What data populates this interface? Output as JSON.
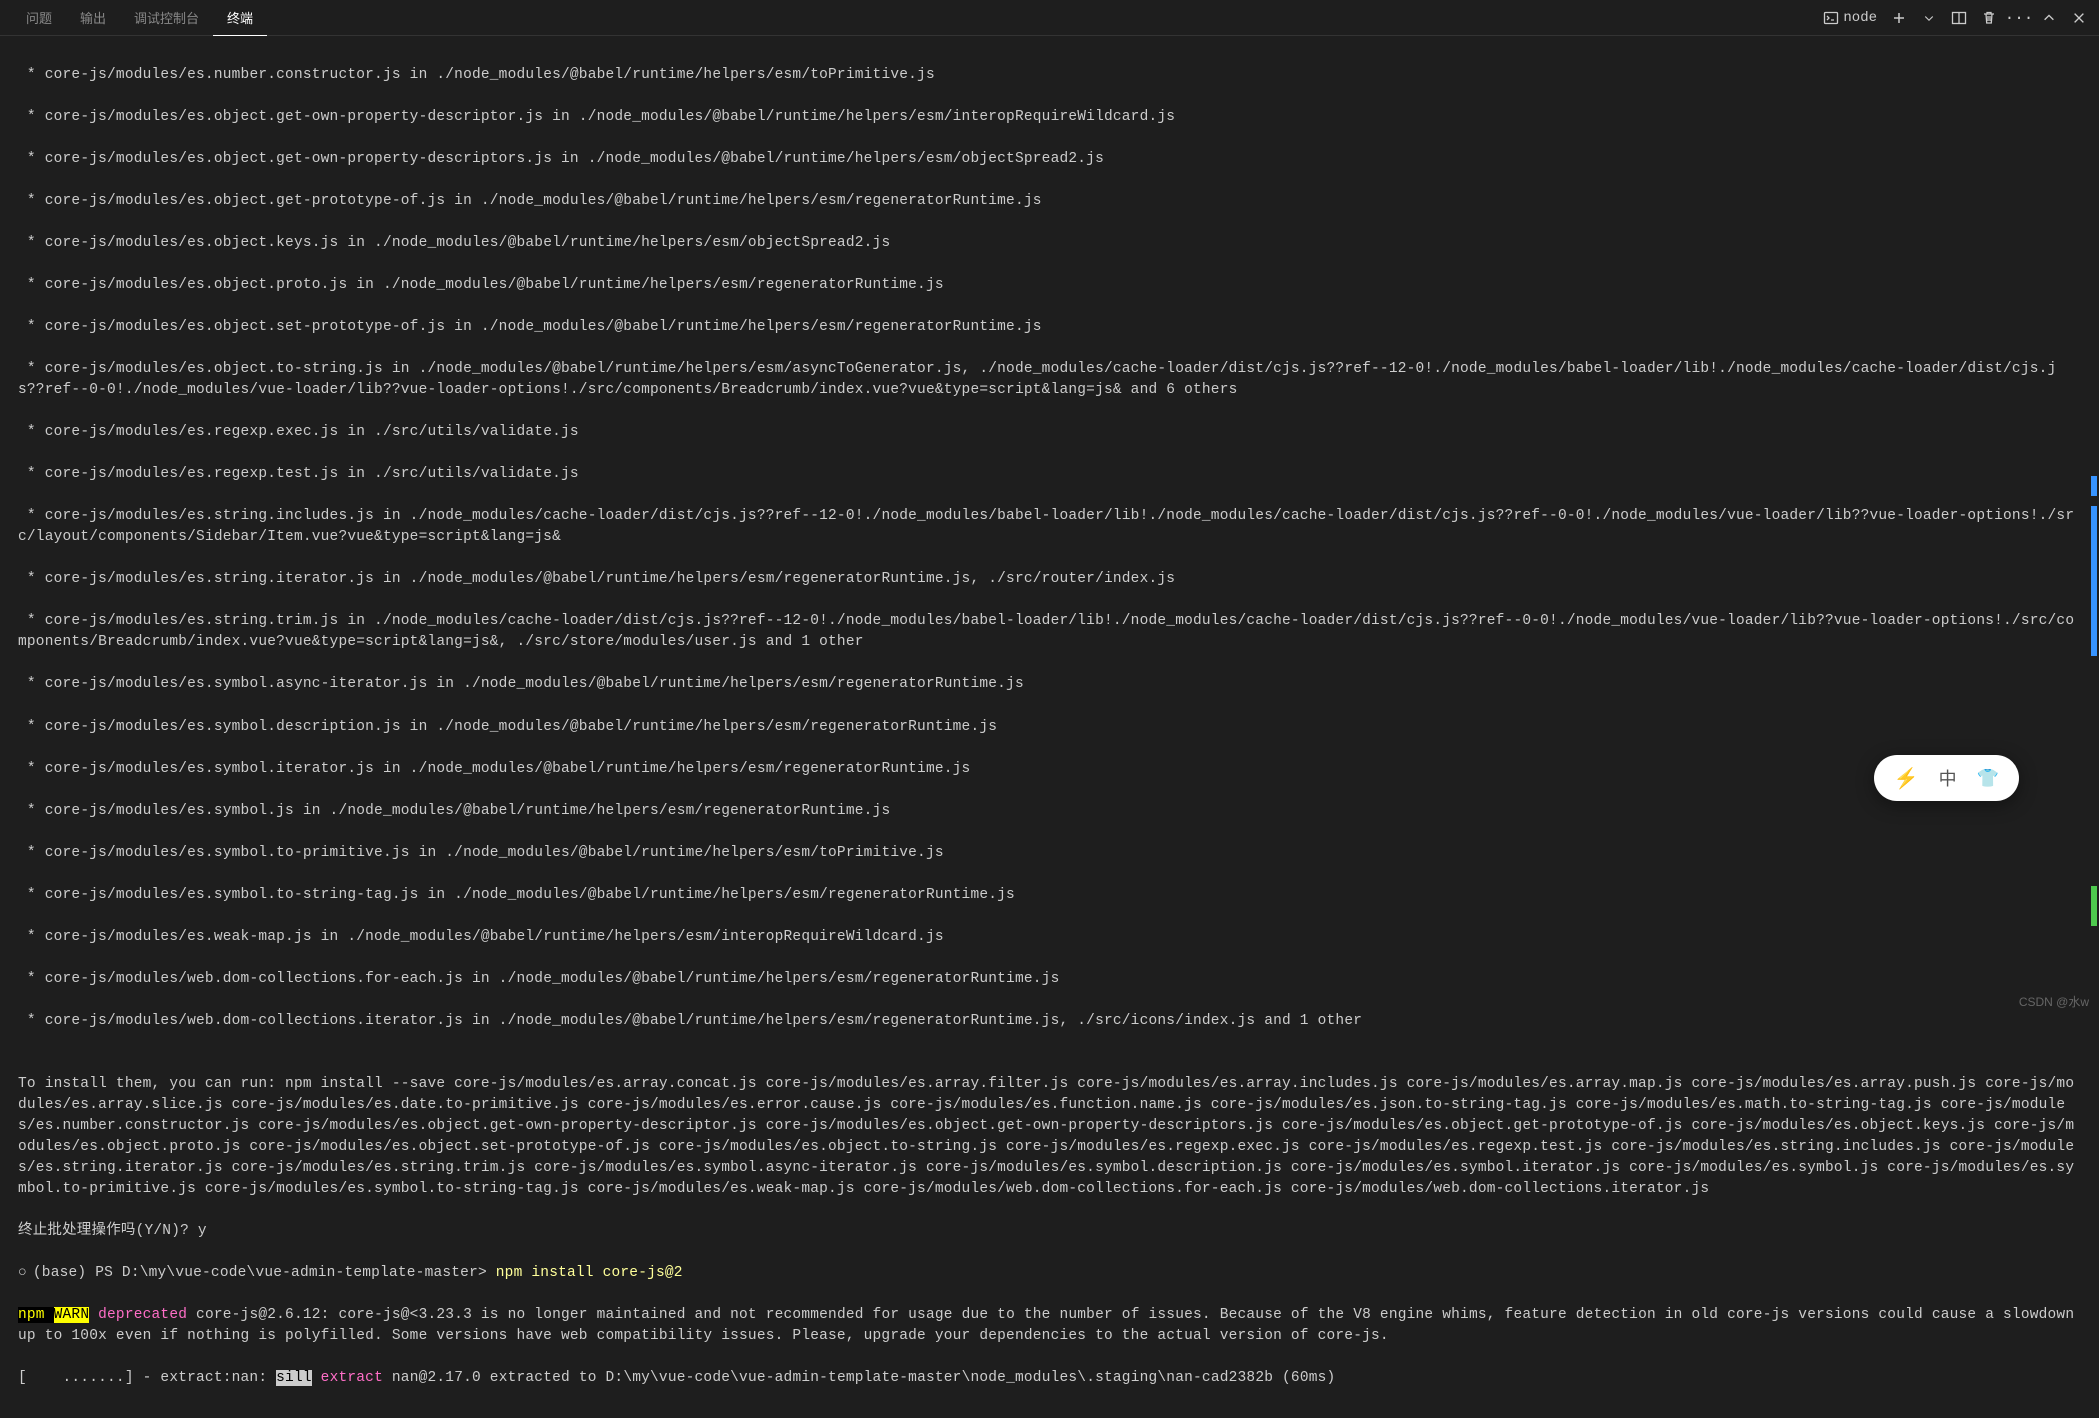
{
  "tabs": {
    "problems": "问题",
    "output": "输出",
    "debug": "调试控制台",
    "terminal": "终端"
  },
  "toolbar": {
    "node_label": "node"
  },
  "lines": {
    "l1": " * core-js/modules/es.number.constructor.js in ./node_modules/@babel/runtime/helpers/esm/toPrimitive.js",
    "l2": " * core-js/modules/es.object.get-own-property-descriptor.js in ./node_modules/@babel/runtime/helpers/esm/interopRequireWildcard.js",
    "l3": " * core-js/modules/es.object.get-own-property-descriptors.js in ./node_modules/@babel/runtime/helpers/esm/objectSpread2.js",
    "l4": " * core-js/modules/es.object.get-prototype-of.js in ./node_modules/@babel/runtime/helpers/esm/regeneratorRuntime.js",
    "l5": " * core-js/modules/es.object.keys.js in ./node_modules/@babel/runtime/helpers/esm/objectSpread2.js",
    "l6": " * core-js/modules/es.object.proto.js in ./node_modules/@babel/runtime/helpers/esm/regeneratorRuntime.js",
    "l7": " * core-js/modules/es.object.set-prototype-of.js in ./node_modules/@babel/runtime/helpers/esm/regeneratorRuntime.js",
    "l8": " * core-js/modules/es.object.to-string.js in ./node_modules/@babel/runtime/helpers/esm/asyncToGenerator.js, ./node_modules/cache-loader/dist/cjs.js??ref--12-0!./node_modules/babel-loader/lib!./node_modules/cache-loader/dist/cjs.js??ref--0-0!./node_modules/vue-loader/lib??vue-loader-options!./src/components/Breadcrumb/index.vue?vue&type=script&lang=js& and 6 others",
    "l9": " * core-js/modules/es.regexp.exec.js in ./src/utils/validate.js",
    "l10": " * core-js/modules/es.regexp.test.js in ./src/utils/validate.js",
    "l11": " * core-js/modules/es.string.includes.js in ./node_modules/cache-loader/dist/cjs.js??ref--12-0!./node_modules/babel-loader/lib!./node_modules/cache-loader/dist/cjs.js??ref--0-0!./node_modules/vue-loader/lib??vue-loader-options!./src/layout/components/Sidebar/Item.vue?vue&type=script&lang=js&",
    "l12": " * core-js/modules/es.string.iterator.js in ./node_modules/@babel/runtime/helpers/esm/regeneratorRuntime.js, ./src/router/index.js",
    "l13": " * core-js/modules/es.string.trim.js in ./node_modules/cache-loader/dist/cjs.js??ref--12-0!./node_modules/babel-loader/lib!./node_modules/cache-loader/dist/cjs.js??ref--0-0!./node_modules/vue-loader/lib??vue-loader-options!./src/components/Breadcrumb/index.vue?vue&type=script&lang=js&, ./src/store/modules/user.js and 1 other",
    "l14": " * core-js/modules/es.symbol.async-iterator.js in ./node_modules/@babel/runtime/helpers/esm/regeneratorRuntime.js",
    "l15": " * core-js/modules/es.symbol.description.js in ./node_modules/@babel/runtime/helpers/esm/regeneratorRuntime.js",
    "l16": " * core-js/modules/es.symbol.iterator.js in ./node_modules/@babel/runtime/helpers/esm/regeneratorRuntime.js",
    "l17": " * core-js/modules/es.symbol.js in ./node_modules/@babel/runtime/helpers/esm/regeneratorRuntime.js",
    "l18": " * core-js/modules/es.symbol.to-primitive.js in ./node_modules/@babel/runtime/helpers/esm/toPrimitive.js",
    "l19": " * core-js/modules/es.symbol.to-string-tag.js in ./node_modules/@babel/runtime/helpers/esm/regeneratorRuntime.js",
    "l20": " * core-js/modules/es.weak-map.js in ./node_modules/@babel/runtime/helpers/esm/interopRequireWildcard.js",
    "l21": " * core-js/modules/web.dom-collections.for-each.js in ./node_modules/@babel/runtime/helpers/esm/regeneratorRuntime.js",
    "l22": " * core-js/modules/web.dom-collections.iterator.js in ./node_modules/@babel/runtime/helpers/esm/regeneratorRuntime.js, ./src/icons/index.js and 1 other",
    "blank": "",
    "install_msg": "To install them, you can run: npm install --save core-js/modules/es.array.concat.js core-js/modules/es.array.filter.js core-js/modules/es.array.includes.js core-js/modules/es.array.map.js core-js/modules/es.array.push.js core-js/modules/es.array.slice.js core-js/modules/es.date.to-primitive.js core-js/modules/es.error.cause.js core-js/modules/es.function.name.js core-js/modules/es.json.to-string-tag.js core-js/modules/es.math.to-string-tag.js core-js/modules/es.number.constructor.js core-js/modules/es.object.get-own-property-descriptor.js core-js/modules/es.object.get-own-property-descriptors.js core-js/modules/es.object.get-prototype-of.js core-js/modules/es.object.keys.js core-js/modules/es.object.proto.js core-js/modules/es.object.set-prototype-of.js core-js/modules/es.object.to-string.js core-js/modules/es.regexp.exec.js core-js/modules/es.regexp.test.js core-js/modules/es.string.includes.js core-js/modules/es.string.iterator.js core-js/modules/es.string.trim.js core-js/modules/es.symbol.async-iterator.js core-js/modules/es.symbol.description.js core-js/modules/es.symbol.iterator.js core-js/modules/es.symbol.js core-js/modules/es.symbol.to-primitive.js core-js/modules/es.symbol.to-string-tag.js core-js/modules/es.weak-map.js core-js/modules/web.dom-collections.for-each.js core-js/modules/web.dom-collections.iterator.js",
    "abort_q": "终止批处理操作吗(Y/N)? y",
    "prompt_prefix": "(base) PS D:\\my\\vue-code\\vue-admin-template-master> ",
    "prompt_cmd": "npm install core-js@2",
    "npm_label": "npm ",
    "warn_label": "WARN",
    "deprecated_label": " deprecated",
    "deprecated_msg": " core-js@2.6.12: core-js@<3.23.3 is no longer maintained and not recommended for usage due to the number of issues. Because of the V8 engine whims, feature detection in old core-js versions could cause a slowdown up to 100x even if nothing is polyfilled. Some versions have web compatibility issues. Please, upgrade your dependencies to the actual version of core-js.",
    "progress_prefix": "[    .......] - extract:nan: ",
    "sill": "sill",
    "extract_word": " extract",
    "extract_rest": " nan@2.17.0 extracted to D:\\my\\vue-code\\vue-admin-template-master\\node_modules\\.staging\\nan-cad2382b (60ms)"
  },
  "ime": {
    "zhong": "中"
  },
  "watermark": "CSDN @水w"
}
